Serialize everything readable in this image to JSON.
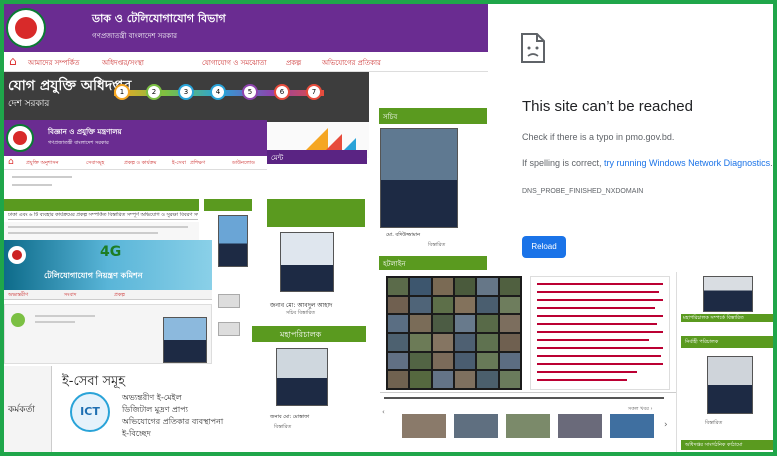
{
  "win1": {
    "title": "ডাক ও টেলিযোগাযোগ বিভাগ",
    "subtitle": "গণপ্রজাতন্ত্রী বাংলাদেশ সরকার",
    "nav": [
      "আমাদের সম্পর্কিত",
      "অধিদপ্তর/সংস্থা",
      "যোগাযোগ ও সমঝোতা",
      "প্রকল্প",
      "অভিযোগের প্রতিকার"
    ]
  },
  "win2": {
    "title": "যোগ প্রযুক্তি অধিদপ্তর",
    "subtitle": "দেশ সরকার",
    "steps": [
      "1",
      "2",
      "3",
      "4",
      "5",
      "6",
      "7"
    ]
  },
  "win3": {
    "title": "বিজ্ঞান ও প্রযুক্তি মন্ত্রণালয়",
    "subtitle": "গণপ্রজাতন্ত্রী বাংলাদেশ সরকার",
    "nav": [
      "প্রযুক্তি অনুশাসন",
      "সেবাসমূহ",
      "প্রকল্প ও কার্যক্রম",
      "ই-সেবা",
      "প্রশিক্ষণ",
      "ডাউনলোড"
    ],
    "tag": "মেন্ট"
  },
  "panel_secretary": {
    "header": "সচিব",
    "name": "মো. বদিউজ্জামান",
    "role": "বিস্তারিত"
  },
  "panel_minister": {
    "name": "জনাব মো: আবদুল আহাদ",
    "role": "সচিব বিস্তারিত"
  },
  "panel_dg": {
    "header": "মহাপরিচালক",
    "name": "জনাব মো: মোস্তাফা",
    "role": "বিস্তারিত"
  },
  "hotline": {
    "header": "হটলাইন"
  },
  "eservice": {
    "title": "ই-সেবা সমূহ",
    "items": [
      "অভ্যন্তরীণ ই-মেইল",
      "ডিজিটাল মুদ্রণ প্রাপ্য",
      "অভিযোগের প্রতিকার ব্যবস্থাপনা",
      "ই-বিচ্ছেদ"
    ],
    "side_title": "কর্মকর্তা"
  },
  "banner": {
    "tag": "4G",
    "line": "টেলিযোগাযোগ নিয়ন্ত্রণ কমিশন"
  },
  "left_links": [
    "অভ্যন্তরীণ",
    "সংবাদ",
    "প্রকল্প"
  ],
  "error": {
    "title": "This site can’t be reached",
    "line1": "Check if there is a typo in pmo.gov.bd.",
    "line2_prefix": "If spelling is correct, ",
    "line2_link": "try running Windows Network Diagnostics",
    "line2_suffix": ".",
    "code": "DNS_PROBE_FINISHED_NXDOMAIN",
    "reload": "Reload"
  },
  "right_panel": {
    "caption1": "মহাপরিচালক সম্পর্কে বিস্তারিত",
    "header2": "নির্বাহী পরিচালক",
    "caption2": "বিস্তারিত",
    "footer": "অধিদপ্তর সাংগঠনিক কাঠামো"
  },
  "news": {
    "ticker": "ঢাকা এবং ৬ টি ব্যবহার কার্যক্রমের প্রকল্প সম্পর্কিত বিস্তারিত সম্পূর্ণ অভিযোগ ও সুরক্ষা বিবরণ সভা",
    "more": "সকল খবর ›"
  }
}
